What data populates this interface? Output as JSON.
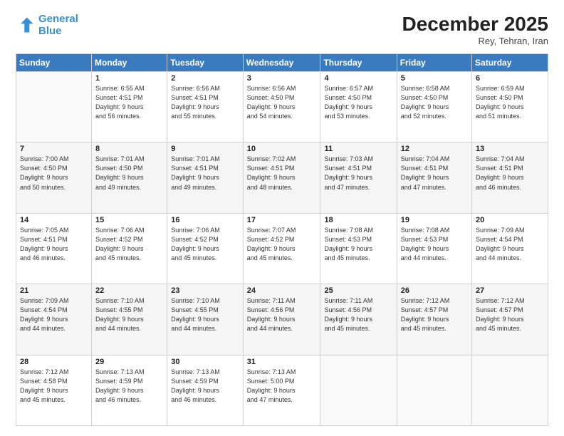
{
  "logo": {
    "line1": "General",
    "line2": "Blue"
  },
  "title": "December 2025",
  "subtitle": "Rey, Tehran, Iran",
  "days_header": [
    "Sunday",
    "Monday",
    "Tuesday",
    "Wednesday",
    "Thursday",
    "Friday",
    "Saturday"
  ],
  "weeks": [
    [
      {
        "num": "",
        "detail": ""
      },
      {
        "num": "1",
        "detail": "Sunrise: 6:55 AM\nSunset: 4:51 PM\nDaylight: 9 hours\nand 56 minutes."
      },
      {
        "num": "2",
        "detail": "Sunrise: 6:56 AM\nSunset: 4:51 PM\nDaylight: 9 hours\nand 55 minutes."
      },
      {
        "num": "3",
        "detail": "Sunrise: 6:56 AM\nSunset: 4:50 PM\nDaylight: 9 hours\nand 54 minutes."
      },
      {
        "num": "4",
        "detail": "Sunrise: 6:57 AM\nSunset: 4:50 PM\nDaylight: 9 hours\nand 53 minutes."
      },
      {
        "num": "5",
        "detail": "Sunrise: 6:58 AM\nSunset: 4:50 PM\nDaylight: 9 hours\nand 52 minutes."
      },
      {
        "num": "6",
        "detail": "Sunrise: 6:59 AM\nSunset: 4:50 PM\nDaylight: 9 hours\nand 51 minutes."
      }
    ],
    [
      {
        "num": "7",
        "detail": "Sunrise: 7:00 AM\nSunset: 4:50 PM\nDaylight: 9 hours\nand 50 minutes."
      },
      {
        "num": "8",
        "detail": "Sunrise: 7:01 AM\nSunset: 4:50 PM\nDaylight: 9 hours\nand 49 minutes."
      },
      {
        "num": "9",
        "detail": "Sunrise: 7:01 AM\nSunset: 4:51 PM\nDaylight: 9 hours\nand 49 minutes."
      },
      {
        "num": "10",
        "detail": "Sunrise: 7:02 AM\nSunset: 4:51 PM\nDaylight: 9 hours\nand 48 minutes."
      },
      {
        "num": "11",
        "detail": "Sunrise: 7:03 AM\nSunset: 4:51 PM\nDaylight: 9 hours\nand 47 minutes."
      },
      {
        "num": "12",
        "detail": "Sunrise: 7:04 AM\nSunset: 4:51 PM\nDaylight: 9 hours\nand 47 minutes."
      },
      {
        "num": "13",
        "detail": "Sunrise: 7:04 AM\nSunset: 4:51 PM\nDaylight: 9 hours\nand 46 minutes."
      }
    ],
    [
      {
        "num": "14",
        "detail": "Sunrise: 7:05 AM\nSunset: 4:51 PM\nDaylight: 9 hours\nand 46 minutes."
      },
      {
        "num": "15",
        "detail": "Sunrise: 7:06 AM\nSunset: 4:52 PM\nDaylight: 9 hours\nand 45 minutes."
      },
      {
        "num": "16",
        "detail": "Sunrise: 7:06 AM\nSunset: 4:52 PM\nDaylight: 9 hours\nand 45 minutes."
      },
      {
        "num": "17",
        "detail": "Sunrise: 7:07 AM\nSunset: 4:52 PM\nDaylight: 9 hours\nand 45 minutes."
      },
      {
        "num": "18",
        "detail": "Sunrise: 7:08 AM\nSunset: 4:53 PM\nDaylight: 9 hours\nand 45 minutes."
      },
      {
        "num": "19",
        "detail": "Sunrise: 7:08 AM\nSunset: 4:53 PM\nDaylight: 9 hours\nand 44 minutes."
      },
      {
        "num": "20",
        "detail": "Sunrise: 7:09 AM\nSunset: 4:54 PM\nDaylight: 9 hours\nand 44 minutes."
      }
    ],
    [
      {
        "num": "21",
        "detail": "Sunrise: 7:09 AM\nSunset: 4:54 PM\nDaylight: 9 hours\nand 44 minutes."
      },
      {
        "num": "22",
        "detail": "Sunrise: 7:10 AM\nSunset: 4:55 PM\nDaylight: 9 hours\nand 44 minutes."
      },
      {
        "num": "23",
        "detail": "Sunrise: 7:10 AM\nSunset: 4:55 PM\nDaylight: 9 hours\nand 44 minutes."
      },
      {
        "num": "24",
        "detail": "Sunrise: 7:11 AM\nSunset: 4:56 PM\nDaylight: 9 hours\nand 44 minutes."
      },
      {
        "num": "25",
        "detail": "Sunrise: 7:11 AM\nSunset: 4:56 PM\nDaylight: 9 hours\nand 45 minutes."
      },
      {
        "num": "26",
        "detail": "Sunrise: 7:12 AM\nSunset: 4:57 PM\nDaylight: 9 hours\nand 45 minutes."
      },
      {
        "num": "27",
        "detail": "Sunrise: 7:12 AM\nSunset: 4:57 PM\nDaylight: 9 hours\nand 45 minutes."
      }
    ],
    [
      {
        "num": "28",
        "detail": "Sunrise: 7:12 AM\nSunset: 4:58 PM\nDaylight: 9 hours\nand 45 minutes."
      },
      {
        "num": "29",
        "detail": "Sunrise: 7:13 AM\nSunset: 4:59 PM\nDaylight: 9 hours\nand 46 minutes."
      },
      {
        "num": "30",
        "detail": "Sunrise: 7:13 AM\nSunset: 4:59 PM\nDaylight: 9 hours\nand 46 minutes."
      },
      {
        "num": "31",
        "detail": "Sunrise: 7:13 AM\nSunset: 5:00 PM\nDaylight: 9 hours\nand 47 minutes."
      },
      {
        "num": "",
        "detail": ""
      },
      {
        "num": "",
        "detail": ""
      },
      {
        "num": "",
        "detail": ""
      }
    ]
  ]
}
